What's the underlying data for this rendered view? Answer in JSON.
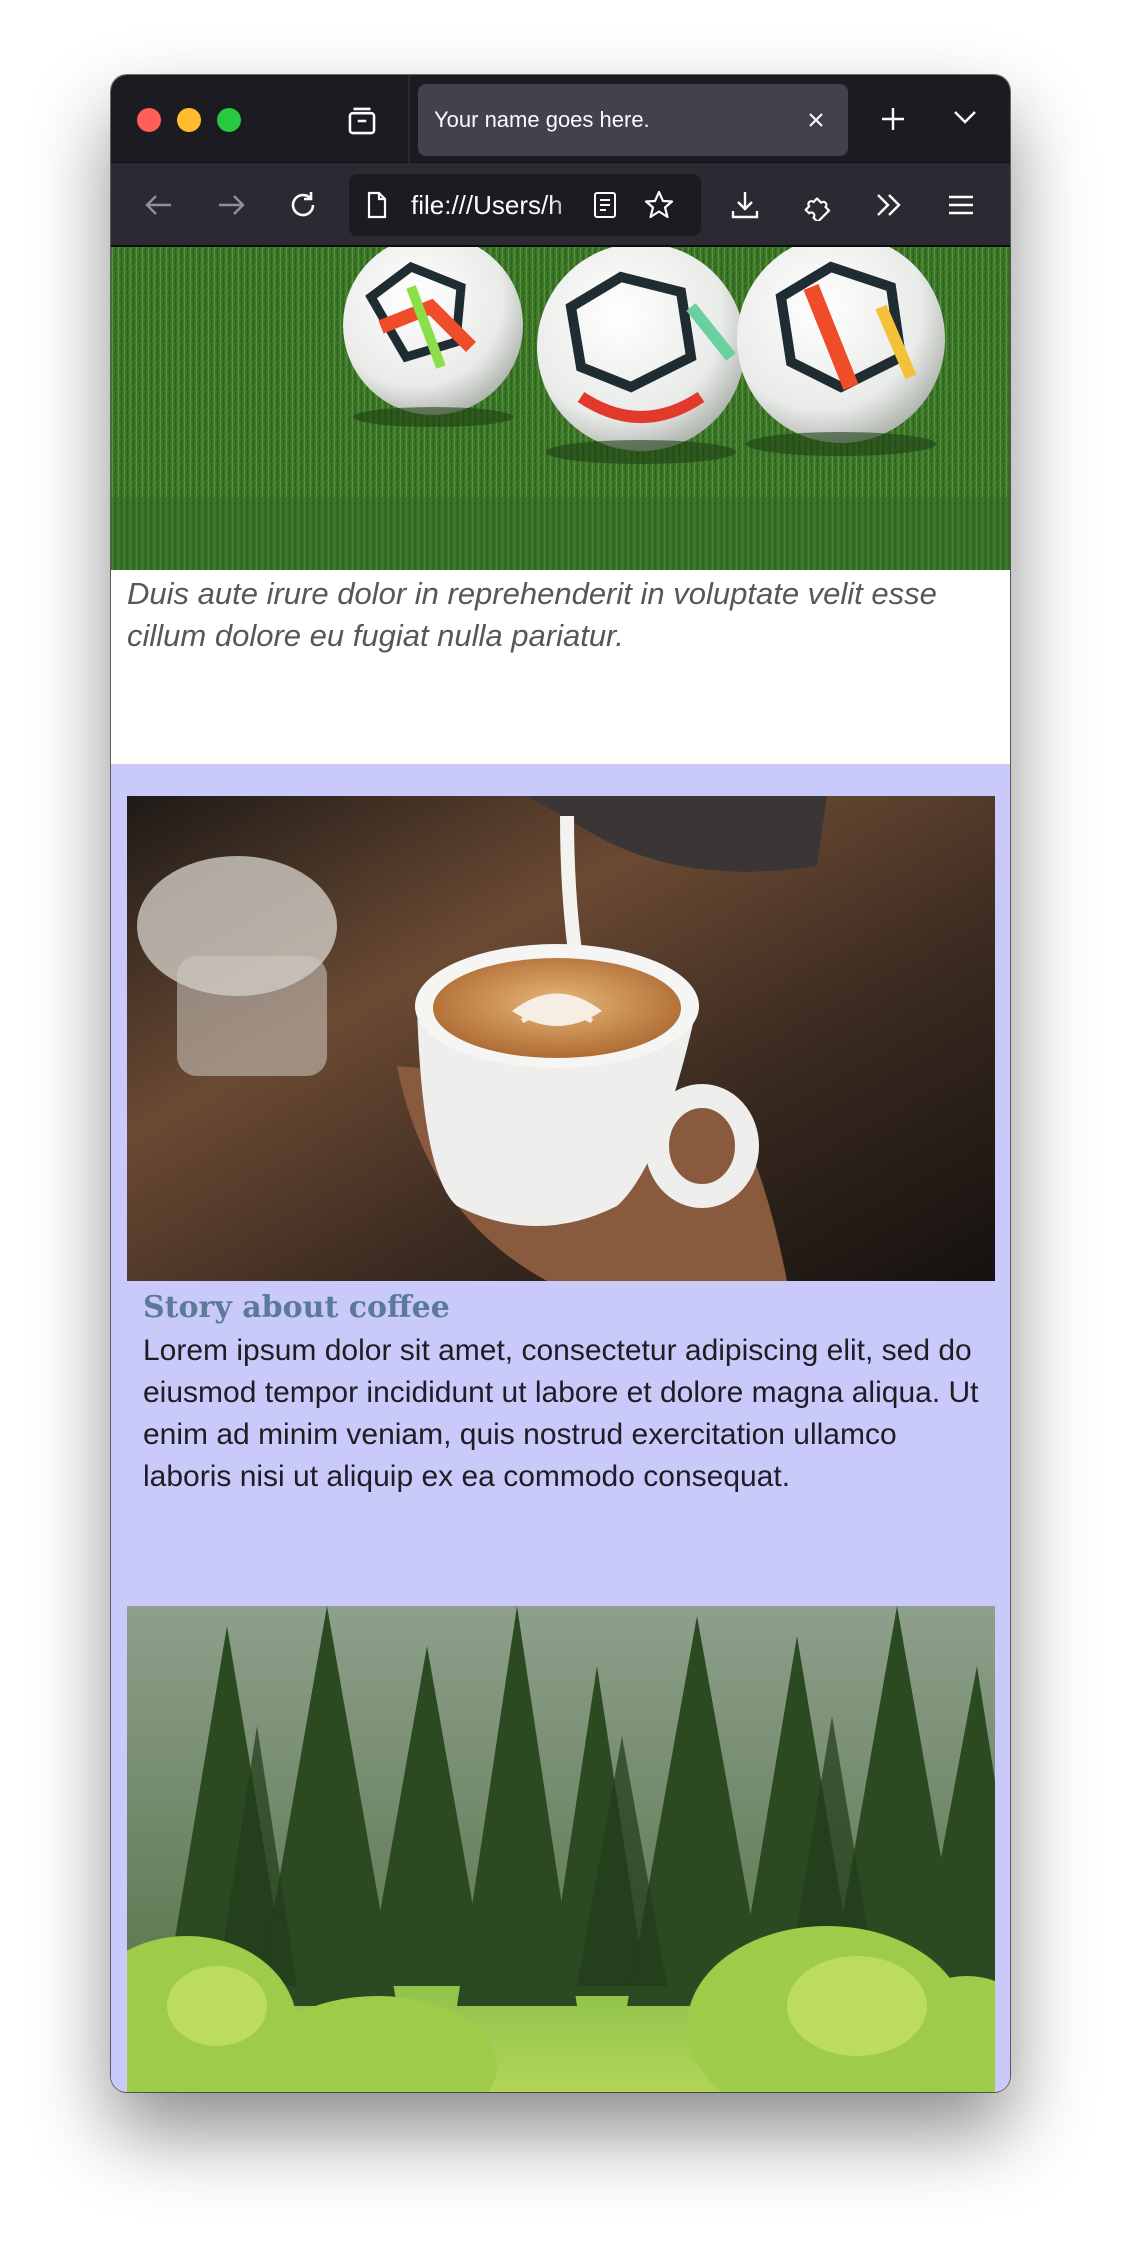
{
  "browser": {
    "tab_title": "Your name goes here.",
    "url": "file:///Users/h",
    "icons": {
      "tab_list": "tab-list-icon",
      "close_tab": "close-icon",
      "new_tab": "plus-icon",
      "all_tabs": "chevron-down-icon",
      "back": "arrow-left-icon",
      "forward": "arrow-right-icon",
      "reload": "reload-icon",
      "page": "page-icon",
      "reader": "reader-view-icon",
      "bookmark": "star-icon",
      "downloads": "download-icon",
      "extensions": "puzzle-icon",
      "overflow": "double-chevron-right-icon",
      "menu": "hamburger-menu-icon"
    },
    "colors": {
      "tabstrip": "#1c1b22",
      "navbar": "#2b2a33",
      "active_tab": "#42414d",
      "close": "#ff5f57",
      "minimize": "#febc2e",
      "zoom": "#28c840"
    }
  },
  "page": {
    "hero_image": "soccer-balls-on-grass",
    "caption": "Duis aute irure dolor in reprehenderit in voluptate velit esse cillum dolore eu fugiat nulla pariatur.",
    "story": {
      "image": "latte-art-coffee-cup",
      "title": "Story about coffee",
      "body": "Lorem ipsum dolor sit amet, consectetur adipiscing elit, sed do eiusmod tempor incididunt ut labore et dolore magna aliqua. Ut enim ad minim veniam, quis nostrud exercitation ullamco laboris nisi ut aliquip ex ea commodo consequat."
    },
    "forest_image": "pine-forest",
    "colors": {
      "story_background": "#c9c9fa",
      "story_title": "#5a7a96",
      "caption_text": "#56575c"
    }
  }
}
